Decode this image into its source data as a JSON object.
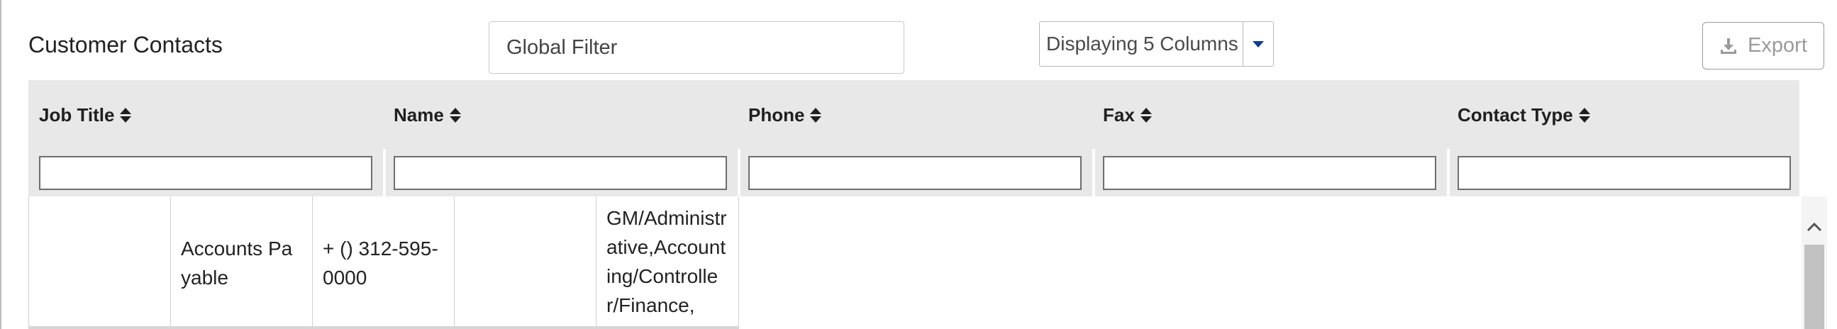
{
  "page": {
    "title": "Customer Contacts"
  },
  "toolbar": {
    "global_filter_placeholder": "Global Filter",
    "columns_select_label": "Displaying 5 Columns",
    "export_label": "Export"
  },
  "table": {
    "columns": [
      {
        "label": "Job Title"
      },
      {
        "label": "Name"
      },
      {
        "label": "Phone"
      },
      {
        "label": "Fax"
      },
      {
        "label": "Contact Type"
      }
    ],
    "rows": [
      {
        "cells": [
          "",
          "Accounts Payable",
          "+ () 312-595-0000",
          "",
          "GM/Administrative,Accounting/Controller/Finance,"
        ]
      }
    ]
  },
  "colors": {
    "header_bg": "#e9e8e9",
    "dropdown_arrow": "#123c8c",
    "export_text": "#9a9a9a"
  },
  "icons": {
    "sort": "sort-icon",
    "dropdown": "chevron-down-icon",
    "export": "download-icon",
    "scroll_up": "chevron-up-icon"
  }
}
